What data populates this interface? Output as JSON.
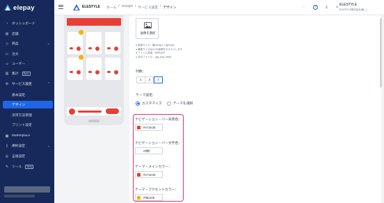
{
  "sidebar": {
    "logo_text": "elepay",
    "items": [
      {
        "label": "ダッシュボード",
        "icon": "dashboard-icon"
      },
      {
        "label": "店舗",
        "icon": "store-icon"
      },
      {
        "label": "商品",
        "icon": "tag-icon"
      },
      {
        "label": "注文",
        "icon": "cart-icon"
      },
      {
        "label": "ユーザー",
        "icon": "user-icon"
      },
      {
        "label": "集計",
        "badge": "Beta",
        "icon": "chart-icon"
      },
      {
        "label": "サービス設定",
        "icon": "gear-icon"
      },
      {
        "label": "基本設定"
      },
      {
        "label": "デザイン"
      },
      {
        "label": "決済方法管理"
      },
      {
        "label": "プリント設定"
      },
      {
        "label": "Marketplace",
        "icon": "grid-icon"
      },
      {
        "label": "規約設定",
        "icon": "document-icon"
      },
      {
        "label": "言語設定",
        "icon": "globe-icon"
      },
      {
        "label": "ツール",
        "badge": "Beta",
        "icon": "tool-icon"
      }
    ]
  },
  "topbar": {
    "brand": "ELESTYLE",
    "breadcrumb": [
      "ホーム",
      "/",
      "OneQR",
      "/",
      "サービス設定",
      "/",
      "デザイン"
    ],
    "user_name": "ELESTYLE",
    "user_company": "ELESTYLE株式会社(管...)"
  },
  "upload": {
    "button_label": "画像を選択",
    "notes": [
      "推奨サイズ：横2400px × 高100px",
      "横縦サイズは4:1の画像をオススメします",
      "ファイル容量：5MB以内",
      "対応ファイル：.jpg,.png,.webp"
    ]
  },
  "columns": {
    "label": "列数：",
    "options": [
      "1",
      "2",
      "3"
    ],
    "selected": "3"
  },
  "theme": {
    "label": "テーマ設定：",
    "options": [
      "カスタマイズ",
      "テーマを選択"
    ],
    "selected": "カスタマイズ",
    "fields": [
      {
        "label": "ナビゲーション・バー背景色：",
        "value": "#e73e38",
        "color": "#e73e38"
      },
      {
        "label": "ナビゲーション・バー文字色：",
        "value": "#ffffff",
        "color": "#ffffff"
      },
      {
        "label": "テーマ・メインカラー：",
        "value": "#e73e38",
        "color": "#e73e38"
      },
      {
        "label": "テーマ・アクセントカラー：",
        "value": "#f8b20b",
        "color": "#f8b20b"
      }
    ]
  },
  "colors": {
    "sidebar_bg": "#16295a",
    "active": "#1e66e6",
    "highlight": "#e0336e"
  }
}
